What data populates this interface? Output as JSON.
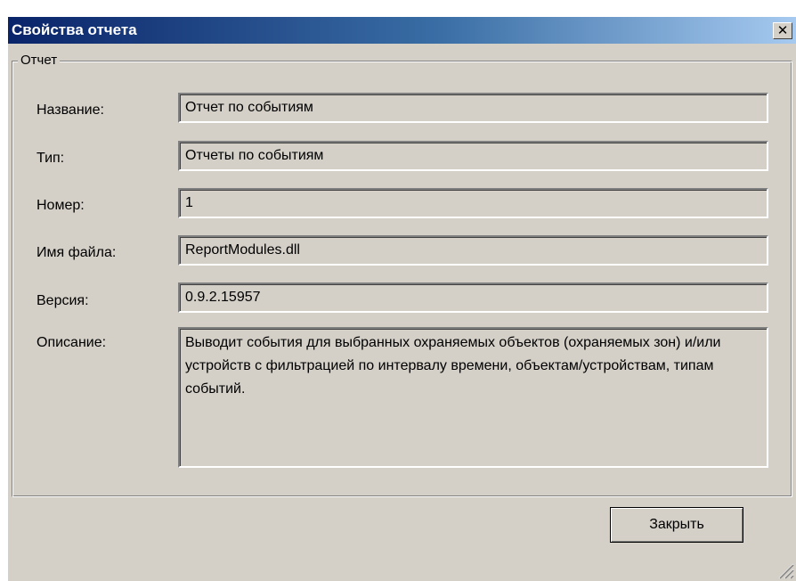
{
  "window": {
    "title": "Свойства отчета",
    "close_glyph": "✕",
    "close_icon": "close-icon"
  },
  "group": {
    "label": "Отчет"
  },
  "fields": {
    "name": {
      "label": "Название:",
      "value": "Отчет по событиям"
    },
    "type": {
      "label": "Тип:",
      "value": "Отчеты по событиям"
    },
    "number": {
      "label": "Номер:",
      "value": "1"
    },
    "filename": {
      "label": "Имя файла:",
      "value": "ReportModules.dll"
    },
    "version": {
      "label": "Версия:",
      "value": "0.9.2.15957"
    },
    "description": {
      "label": "Описание:",
      "value": "Выводит события для выбранных охраняемых объектов (охраняемых зон) и/или устройств с фильтрацией по интервалу времени, объектам/устройствам, типам событий."
    }
  },
  "buttons": {
    "close_label": "Закрыть"
  },
  "colors": {
    "face": "#d4d0c8",
    "title_start": "#0a246a",
    "title_end": "#a6caf0"
  }
}
